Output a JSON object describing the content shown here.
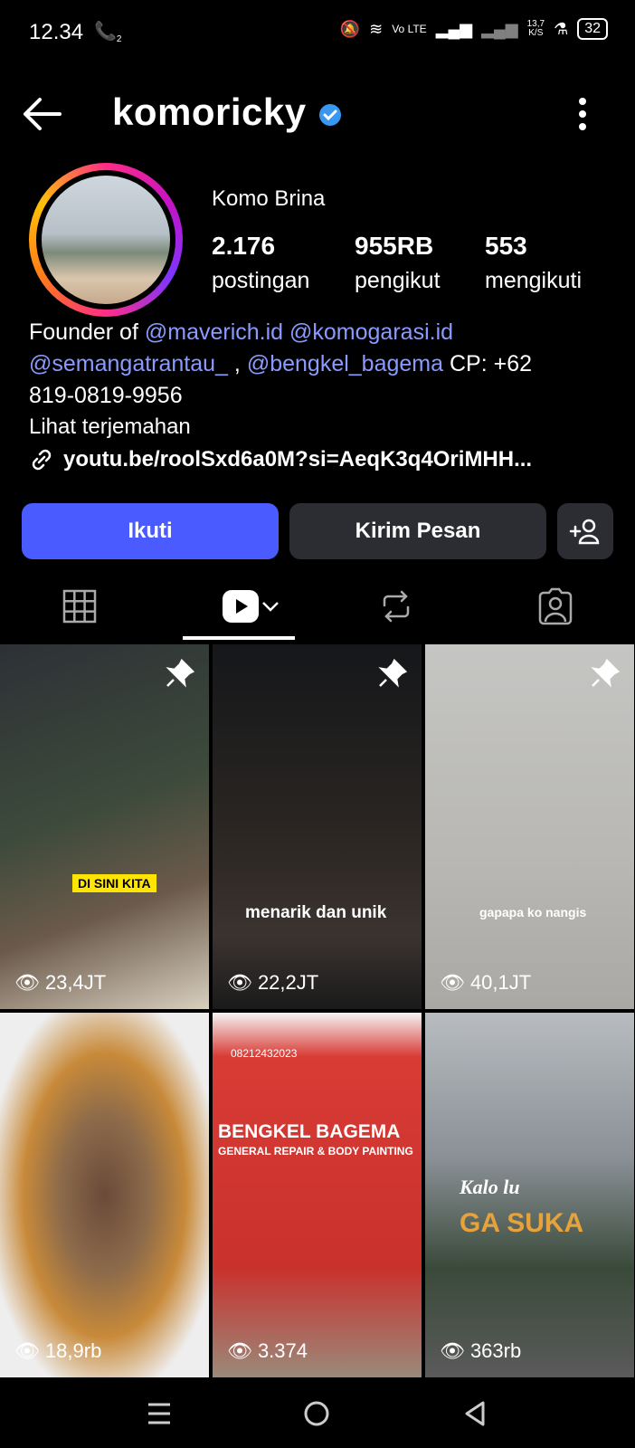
{
  "status": {
    "time": "12.34",
    "call_badge": "2",
    "network": "Vo LTE",
    "speed_value": "13,7",
    "speed_unit": "K/S",
    "battery": "32"
  },
  "header": {
    "username": "komoricky",
    "verified_icon": "verified-badge-icon",
    "menu_icon": "more-vert-icon"
  },
  "profile": {
    "name": "Komo Brina",
    "stats": [
      {
        "value": "2.176",
        "label": "postingan"
      },
      {
        "value": "955RB",
        "label": "pengikut"
      },
      {
        "value": "553",
        "label": "mengikuti"
      }
    ]
  },
  "bio": {
    "prefix": "Founder of ",
    "mention1": "@maverich.id",
    "mention2": "@komogarasi.id",
    "mention3": "@semangatrantau_",
    "sep": " ,",
    "mention4": "@bengkel_bagema",
    "cp": " CP: +62",
    "phone": "819-0819-9956",
    "translate": "Lihat terjemahan",
    "link": "youtu.be/roolSxd6a0M?si=AeqK3q4OriMHH..."
  },
  "actions": {
    "follow": "Ikuti",
    "message": "Kirim Pesan"
  },
  "tabs": [
    "grid-icon",
    "reels-icon",
    "repost-icon",
    "tagged-icon"
  ],
  "posts": [
    {
      "views": "23,4JT",
      "caption": "DI SINI KITA",
      "pinned": true
    },
    {
      "views": "22,2JT",
      "caption": "menarik dan unik",
      "pinned": true
    },
    {
      "views": "40,1JT",
      "caption": "gapapa ko nangis",
      "pinned": true
    },
    {
      "views": "18,9rb",
      "caption": "",
      "pinned": false
    },
    {
      "views": "3.374",
      "caption": "BENGKEL BAGEMA",
      "subcaption": "GENERAL REPAIR & BODY PAINTING",
      "phone": "08212432023",
      "pinned": false
    },
    {
      "views": "363rb",
      "caption": "GA SUKA",
      "caption_top": "Kalo lu",
      "pinned": false
    }
  ],
  "colors": {
    "accent": "#4a5cff",
    "link": "#8a9bff"
  }
}
